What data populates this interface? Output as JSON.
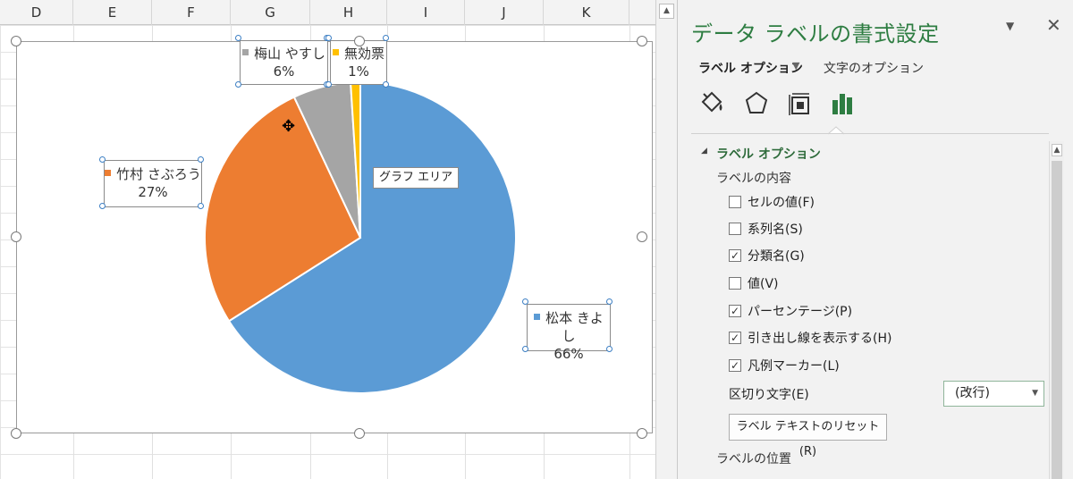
{
  "columns": [
    "D",
    "E",
    "F",
    "G",
    "H",
    "I",
    "J",
    "K"
  ],
  "chart": {
    "tooltip": "グラフ エリア"
  },
  "chart_data": {
    "type": "pie",
    "categories": [
      "松本 きよし",
      "竹村 さぶろう",
      "梅山 やすし",
      "無効票"
    ],
    "values": [
      66,
      27,
      6,
      1
    ],
    "labels": [
      "66%",
      "27%",
      "6%",
      "1%"
    ],
    "colors": [
      "#5b9bd5",
      "#ed7d31",
      "#a5a5a5",
      "#ffc000"
    ],
    "legend": "none",
    "data_labels": "category name and percentage with legend marker"
  },
  "pane": {
    "title": "データ ラベルの書式設定",
    "tab_label_options": "ラベル オプション",
    "tab_text_options": "文字のオプション",
    "section_title": "ラベル オプション",
    "label_contents": "ラベルの内容",
    "options": [
      {
        "label": "セルの値(F)",
        "checked": false
      },
      {
        "label": "系列名(S)",
        "checked": false
      },
      {
        "label": "分類名(G)",
        "checked": true
      },
      {
        "label": "値(V)",
        "checked": false
      },
      {
        "label": "パーセンテージ(P)",
        "checked": true
      },
      {
        "label": "引き出し線を表示する(H)",
        "checked": true
      },
      {
        "label": "凡例マーカー(L)",
        "checked": true
      }
    ],
    "separator_label": "区切り文字(E)",
    "separator_value": "(改行)",
    "reset_button": "ラベル テキストのリセット(R)",
    "label_position": "ラベルの位置"
  }
}
